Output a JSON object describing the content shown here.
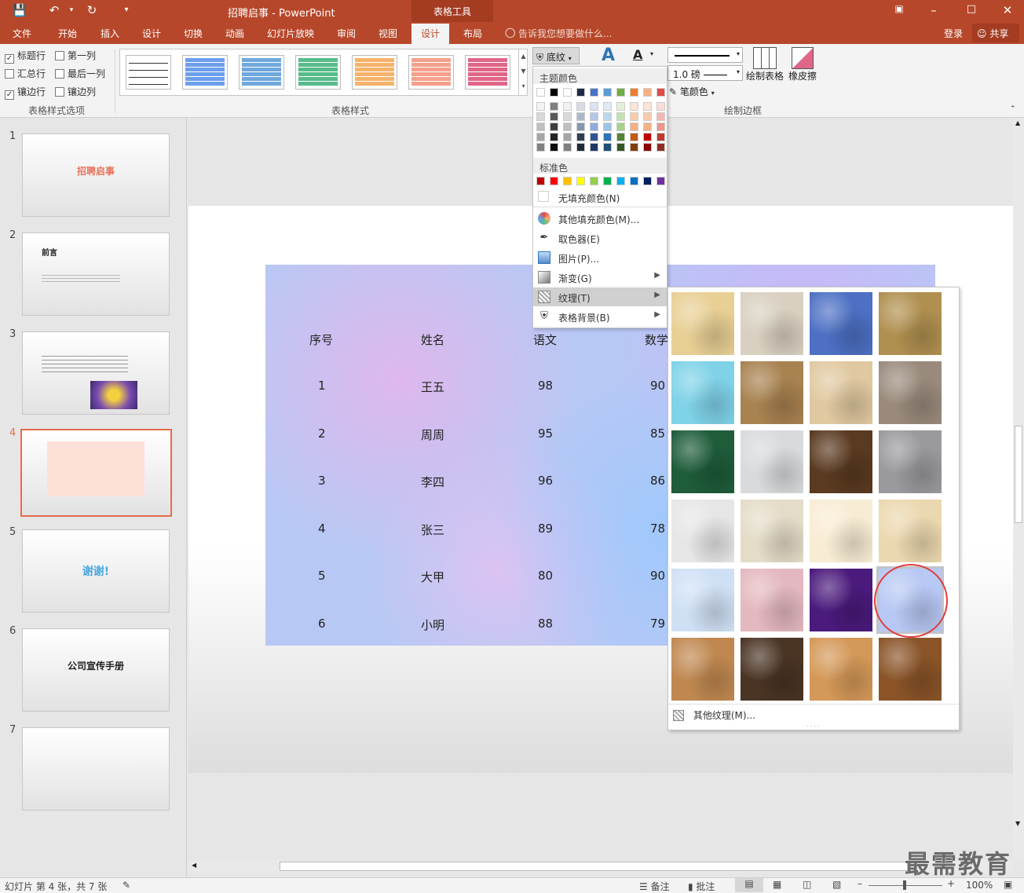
{
  "title_bar": {
    "doc_title": "招聘启事 - PowerPoint",
    "tool_tab": "表格工具"
  },
  "tabs": [
    "文件",
    "开始",
    "插入",
    "设计",
    "切换",
    "动画",
    "幻灯片放映",
    "审阅",
    "视图",
    "设计",
    "布局"
  ],
  "tell_me": "告诉我您想要做什么...",
  "login": "登录",
  "share": "共享",
  "style_options": {
    "items": [
      {
        "label": "标题行",
        "checked": true
      },
      {
        "label": "第一列",
        "checked": false
      },
      {
        "label": "汇总行",
        "checked": false
      },
      {
        "label": "最后一列",
        "checked": false
      },
      {
        "label": "镶边行",
        "checked": true
      },
      {
        "label": "镶边列",
        "checked": false
      }
    ],
    "group_label": "表格样式选项"
  },
  "table_styles": {
    "group_label": "表格样式",
    "swatch_colors": [
      "#ffffff",
      "#6d9eeb",
      "#6fa8dc",
      "#57bb8a",
      "#f6b26b",
      "#f4a08c",
      "#e06688"
    ]
  },
  "ribbon_right": {
    "shading_label": "底纹",
    "pen_weight": "1.0 磅",
    "pen_color_label": "笔颜色",
    "draw_table": "绘制表格",
    "eraser": "橡皮擦",
    "group_label": "绘制边框"
  },
  "color_menu": {
    "theme_header": "主题颜色",
    "standard_header": "标准色",
    "theme_top": [
      "#ffffff",
      "#000000",
      "#ffffff",
      "#1f2a44",
      "#4472c4",
      "#5b9bd5",
      "#70ad47",
      "#ed7d31",
      "#f4b183",
      "#e04c4c"
    ],
    "theme_cols": [
      [
        "#f2f2f2",
        "#d9d9d9",
        "#bfbfbf",
        "#a6a6a6",
        "#808080"
      ],
      [
        "#808080",
        "#595959",
        "#404040",
        "#262626",
        "#0d0d0d"
      ],
      [
        "#f2f2f2",
        "#d9d9d9",
        "#bfbfbf",
        "#a6a6a6",
        "#7f7f7f"
      ],
      [
        "#d6dce5",
        "#adb9ca",
        "#8497b0",
        "#333f50",
        "#222a35"
      ],
      [
        "#dae3f3",
        "#b4c7e7",
        "#8faadc",
        "#2f5597",
        "#1f3864"
      ],
      [
        "#deebf7",
        "#bdd7ee",
        "#9dc3e6",
        "#2e75b6",
        "#1f4e79"
      ],
      [
        "#e2f0d9",
        "#c5e0b4",
        "#a9d18e",
        "#548235",
        "#385723"
      ],
      [
        "#fbe5d6",
        "#f8cbad",
        "#f4b183",
        "#c55a11",
        "#843c0c"
      ],
      [
        "#fce4d6",
        "#f8cbad",
        "#f4b183",
        "#c00000",
        "#8b0000"
      ],
      [
        "#fadbd8",
        "#f5b7b1",
        "#f1948a",
        "#c0392b",
        "#922b21"
      ]
    ],
    "standard": [
      "#c00000",
      "#ff0000",
      "#ffc000",
      "#ffff00",
      "#92d050",
      "#00b050",
      "#00b0f0",
      "#0070c0",
      "#002060",
      "#7030a0"
    ],
    "no_fill": "无填充颜色(N)",
    "items": [
      {
        "label": "其他填充颜色(M)...",
        "icon": "color-wheel-icon",
        "sub": false
      },
      {
        "label": "取色器(E)",
        "icon": "eyedropper-icon",
        "sub": false
      },
      {
        "label": "图片(P)...",
        "icon": "picture-icon",
        "sub": false
      },
      {
        "label": "渐变(G)",
        "icon": "gradient-icon",
        "sub": true
      },
      {
        "label": "纹理(T)",
        "icon": "texture-icon",
        "sub": true,
        "highlight": true
      },
      {
        "label": "表格背景(B)",
        "icon": "table-background-icon",
        "sub": true
      }
    ]
  },
  "texture_panel": {
    "more_textures": "其他纹理(M)...",
    "textures": [
      "#e8cf94",
      "#d8d0c0",
      "#4d70c4",
      "#b09050",
      "#7fd2e8",
      "#a88250",
      "#e0c8a0",
      "#9a8a7c",
      "#1e5c3a",
      "#d8dadc",
      "#5a3a20",
      "#9a9a9e",
      "#e6e6e6",
      "#e4dcc8",
      "#f8ecd4",
      "#ecd8b0",
      "#d0e0f4",
      "#e4b8c0",
      "#4a1a7c",
      "#b8c8f4",
      "#c08850",
      "#4a3424",
      "#d49858",
      "#8a5428"
    ]
  },
  "thumbnails": [
    {
      "num": "1",
      "title": "招聘启事"
    },
    {
      "num": "2",
      "title": "前言"
    },
    {
      "num": "3",
      "title": ""
    },
    {
      "num": "4",
      "title": ""
    },
    {
      "num": "5",
      "title": "谢谢!"
    },
    {
      "num": "6",
      "title": "公司宣传手册"
    },
    {
      "num": "7",
      "title": ""
    }
  ],
  "table": {
    "headers": [
      "序号",
      "姓名",
      "语文",
      "数学"
    ],
    "rows": [
      [
        "1",
        "王五",
        "98",
        "90"
      ],
      [
        "2",
        "周周",
        "95",
        "85"
      ],
      [
        "3",
        "李四",
        "96",
        "86"
      ],
      [
        "4",
        "张三",
        "89",
        "78"
      ],
      [
        "5",
        "大甲",
        "80",
        "90"
      ],
      [
        "6",
        "小明",
        "88",
        "79"
      ]
    ]
  },
  "status": {
    "slide_info": "幻灯片 第 4 张，共 7 张",
    "notes": "备注",
    "comments": "批注",
    "zoom": "100%"
  },
  "watermark": "最需教育"
}
